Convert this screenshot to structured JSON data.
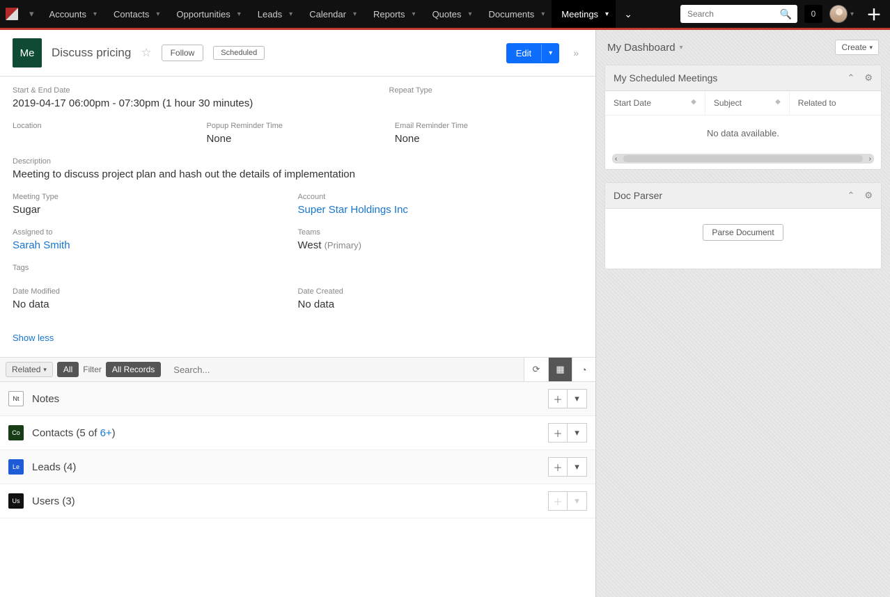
{
  "nav": {
    "items": [
      "Accounts",
      "Contacts",
      "Opportunities",
      "Leads",
      "Calendar",
      "Reports",
      "Quotes",
      "Documents",
      "Meetings"
    ],
    "active_index": 8,
    "search_placeholder": "Search",
    "notification_count": "0"
  },
  "record": {
    "badge": "Me",
    "title": "Discuss pricing",
    "follow_label": "Follow",
    "status_label": "Scheduled",
    "edit_label": "Edit"
  },
  "fields": {
    "start_end_label": "Start & End Date",
    "start_end_value": "2019-04-17 06:00pm - 07:30pm (1 hour 30 minutes)",
    "repeat_label": "Repeat Type",
    "repeat_value": "",
    "location_label": "Location",
    "location_value": "",
    "popup_label": "Popup Reminder Time",
    "popup_value": "None",
    "email_rem_label": "Email Reminder Time",
    "email_rem_value": "None",
    "description_label": "Description",
    "description_value": "Meeting to discuss project plan and hash out the details of implementation",
    "meeting_type_label": "Meeting Type",
    "meeting_type_value": "Sugar",
    "account_label": "Account",
    "account_value": "Super Star Holdings Inc",
    "assigned_label": "Assigned to",
    "assigned_value": "Sarah Smith",
    "teams_label": "Teams",
    "teams_value": "West",
    "teams_suffix": "(Primary)",
    "tags_label": "Tags",
    "date_modified_label": "Date Modified",
    "date_modified_value": "No data",
    "date_created_label": "Date Created",
    "date_created_value": "No data",
    "show_less": "Show less"
  },
  "related": {
    "related_pill": "Related",
    "all_pill": "All",
    "filter_label": "Filter",
    "all_records_pill": "All Records",
    "search_placeholder": "Search...",
    "panels": [
      {
        "code": "Nt",
        "style": "plain",
        "title": "Notes",
        "count": "",
        "extra": "",
        "disabled": false
      },
      {
        "code": "Co",
        "style": "co",
        "title": "Contacts",
        "count": "(5 of ",
        "extra": "6+",
        "suffix": ")",
        "disabled": false
      },
      {
        "code": "Le",
        "style": "le",
        "title": "Leads",
        "count": "(4)",
        "extra": "",
        "disabled": false
      },
      {
        "code": "Us",
        "style": "us",
        "title": "Users",
        "count": "(3)",
        "extra": "",
        "disabled": true
      }
    ]
  },
  "sidebar": {
    "dashboard_title": "My Dashboard",
    "create_label": "Create",
    "dashlets": [
      {
        "title": "My Scheduled Meetings",
        "columns": [
          "Start Date",
          "Subject",
          "Related to"
        ],
        "no_data": "No data available."
      },
      {
        "title": "Doc Parser",
        "button": "Parse Document"
      }
    ]
  }
}
